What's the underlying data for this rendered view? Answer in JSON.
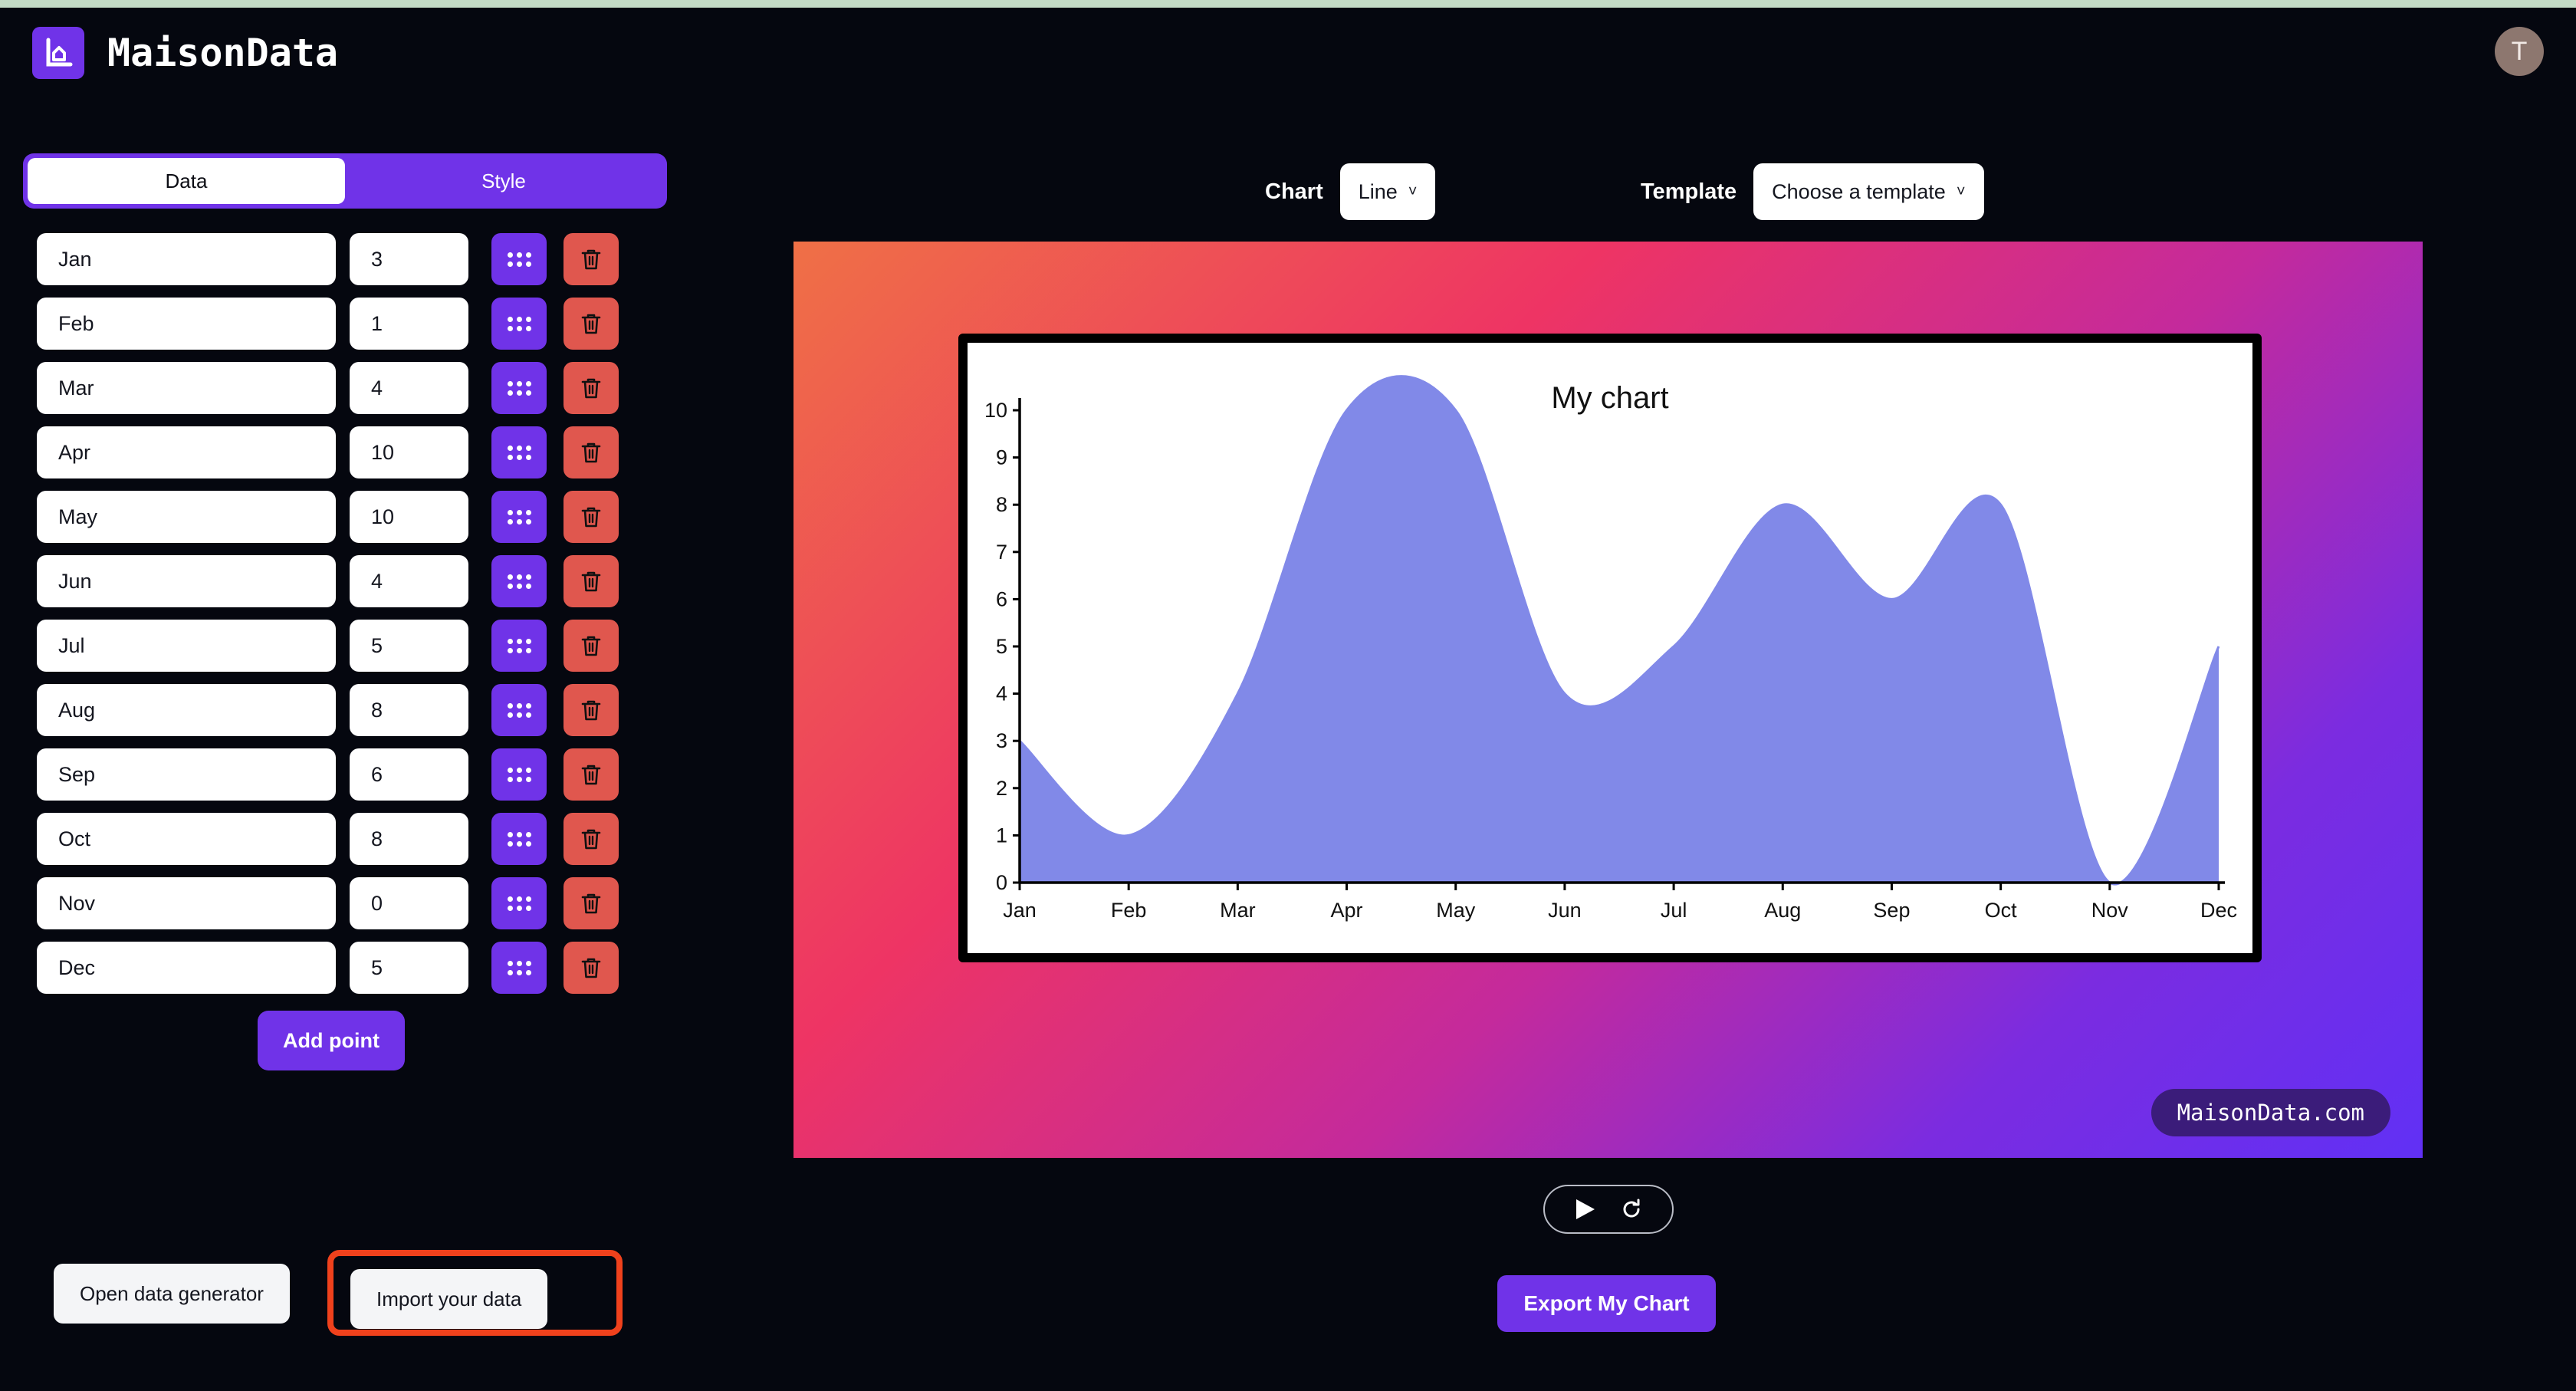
{
  "brand": {
    "name": "MaisonData",
    "logo_icon": "chart-logo-icon"
  },
  "user": {
    "avatar_initial": "T",
    "avatar_color": "#8d776f"
  },
  "tabs": [
    {
      "label": "Data",
      "active": true
    },
    {
      "label": "Style",
      "active": false
    }
  ],
  "data_rows": [
    {
      "label": "Jan",
      "value": "3"
    },
    {
      "label": "Feb",
      "value": "1"
    },
    {
      "label": "Mar",
      "value": "4"
    },
    {
      "label": "Apr",
      "value": "10"
    },
    {
      "label": "May",
      "value": "10"
    },
    {
      "label": "Jun",
      "value": "4"
    },
    {
      "label": "Jul",
      "value": "5"
    },
    {
      "label": "Aug",
      "value": "8"
    },
    {
      "label": "Sep",
      "value": "6"
    },
    {
      "label": "Oct",
      "value": "8"
    },
    {
      "label": "Nov",
      "value": "0"
    },
    {
      "label": "Dec",
      "value": "5"
    }
  ],
  "buttons": {
    "add_point": "Add point",
    "open_generator": "Open data generator",
    "import_data": "Import your data",
    "export_chart": "Export My Chart"
  },
  "controls": {
    "chart_label": "Chart",
    "chart_value": "Line",
    "template_label": "Template",
    "template_value": "Choose a template"
  },
  "preview": {
    "watermark": "MaisonData.com",
    "gradient_from": "#ef7046",
    "gradient_mid": "#ee3464",
    "gradient_to": "#6130f5",
    "play_icon": "play-icon",
    "refresh_icon": "refresh-icon"
  },
  "highlight": {
    "color": "#f0411c",
    "target": "Import your data"
  },
  "accent": {
    "purple": "#7033e8",
    "red": "#e0574e",
    "area": "#8189e8"
  },
  "chart_data": {
    "type": "area",
    "title": "My chart",
    "categories": [
      "Jan",
      "Feb",
      "Mar",
      "Apr",
      "May",
      "Jun",
      "Jul",
      "Aug",
      "Sep",
      "Oct",
      "Nov",
      "Dec"
    ],
    "values": [
      3,
      1,
      4,
      10,
      10,
      4,
      5,
      8,
      6,
      8,
      0,
      5
    ],
    "series": [
      {
        "name": "My chart",
        "values": [
          3,
          1,
          4,
          10,
          10,
          4,
          5,
          8,
          6,
          8,
          0,
          5
        ]
      }
    ],
    "xlabel": "",
    "ylabel": "",
    "ylim": [
      0,
      10
    ],
    "yticks": [
      0,
      1,
      2,
      3,
      4,
      5,
      6,
      7,
      8,
      9,
      10
    ],
    "grid": false,
    "legend": false,
    "fill_color": "#8189e8",
    "curve": "smooth"
  }
}
